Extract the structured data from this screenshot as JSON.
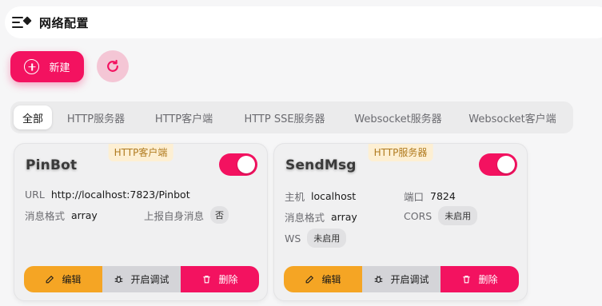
{
  "header": {
    "title": "网络配置"
  },
  "toolbar": {
    "new_label": "新建"
  },
  "tabs": [
    {
      "label": "全部"
    },
    {
      "label": "HTTP服务器"
    },
    {
      "label": "HTTP客户端"
    },
    {
      "label": "HTTP SSE服务器"
    },
    {
      "label": "Websocket服务器"
    },
    {
      "label": "Websocket客户端"
    }
  ],
  "cards": [
    {
      "badge": "HTTP客户端",
      "name": "PinBot",
      "enabled": true,
      "url_label": "URL",
      "url": "http://localhost:7823/Pinbot",
      "format_label": "消息格式",
      "format": "array",
      "report_self_label": "上报自身消息",
      "report_self": "否",
      "actions": {
        "edit": "编辑",
        "debug": "开启调试",
        "delete": "删除"
      }
    },
    {
      "badge": "HTTP服务器",
      "name": "SendMsg",
      "enabled": true,
      "host_label": "主机",
      "host": "localhost",
      "port_label": "端口",
      "port": "7824",
      "format_label": "消息格式",
      "format": "array",
      "cors_label": "CORS",
      "cors": "未启用",
      "ws_label": "WS",
      "ws": "未启用",
      "actions": {
        "edit": "编辑",
        "debug": "开启调试",
        "delete": "删除"
      }
    }
  ],
  "colors": {
    "accent": "#f31260",
    "warning": "#f5a524",
    "badge_bg": "#fdefd3"
  }
}
